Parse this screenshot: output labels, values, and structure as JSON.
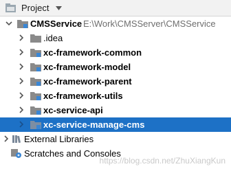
{
  "header": {
    "title": "Project"
  },
  "tree": {
    "root": {
      "name": "CMSService",
      "path": "E:\\Work\\CMSServer\\CMSService"
    },
    "items": [
      {
        "label": ".idea"
      },
      {
        "label": "xc-framework-common"
      },
      {
        "label": "xc-framework-model"
      },
      {
        "label": "xc-framework-parent"
      },
      {
        "label": "xc-framework-utils"
      },
      {
        "label": "xc-service-api"
      },
      {
        "label": "xc-service-manage-cms"
      }
    ],
    "external_libraries": "External Libraries",
    "scratches": "Scratches and Consoles"
  },
  "watermark": "https://blog.csdn.net/ZhuXiangKun",
  "colors": {
    "selection": "#1d71c6",
    "folder": "#8a8a8a",
    "module_dot": "#3a86d4"
  }
}
